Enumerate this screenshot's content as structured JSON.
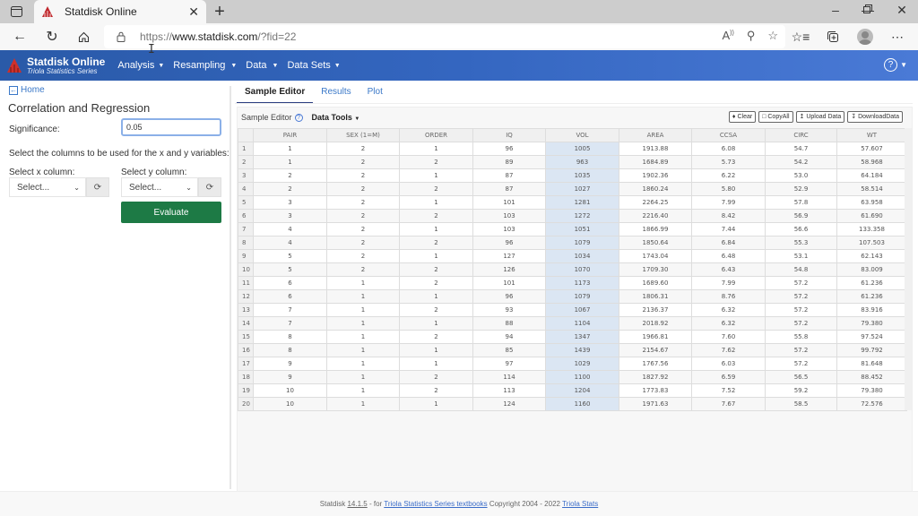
{
  "browser": {
    "tab_title": "Statdisk Online",
    "url_prefix": "https://",
    "url_host": "www.statdisk.com",
    "url_path": "/?fid=22",
    "icons": [
      "sidebar-icon",
      "close-icon",
      "new-tab-icon",
      "minimize-icon",
      "maximize-icon",
      "window-close-icon",
      "back-icon",
      "refresh-icon",
      "home-icon",
      "lock-icon",
      "read-aloud-icon",
      "zoom-out-icon",
      "add-favorite-icon",
      "favorites-icon",
      "collections-icon",
      "profile-icon",
      "more-icon"
    ]
  },
  "app": {
    "brand_name": "Statdisk Online",
    "brand_sub": "Triola Statistics Series",
    "menu": [
      {
        "label": "Analysis"
      },
      {
        "label": "Resampling"
      },
      {
        "label": "Data"
      },
      {
        "label": "Data Sets"
      }
    ],
    "accent": "#2a5aa8"
  },
  "left": {
    "home_label": "Home",
    "title": "Correlation and Regression",
    "significance_label": "Significance:",
    "significance_value": "0.05",
    "instructions": "Select the columns to be used for the x and y variables:",
    "x_label": "Select x column:",
    "y_label": "Select y column:",
    "x_select": "Select...",
    "y_select": "Select...",
    "evaluate_label": "Evaluate",
    "evaluate_color": "#1d7a45"
  },
  "right": {
    "tabs": [
      {
        "label": "Sample Editor",
        "active": true
      },
      {
        "label": "Results",
        "active": false
      },
      {
        "label": "Plot",
        "active": false
      }
    ],
    "editor_label": "Sample Editor",
    "data_tools": "Data Tools",
    "buttons": {
      "clear": "Clear",
      "copy_all": "CopyAll",
      "upload": "Upload Data",
      "download": "DownloadData"
    },
    "columns": [
      "PAIR",
      "SEX (1=M)",
      "ORDER",
      "IQ",
      "VOL",
      "AREA",
      "CCSA",
      "CIRC",
      "WT"
    ],
    "rows": [
      [
        "1",
        "2",
        "1",
        "96",
        "1005",
        "1913.88",
        "6.08",
        "54.7",
        "57.607"
      ],
      [
        "1",
        "2",
        "2",
        "89",
        "963",
        "1684.89",
        "5.73",
        "54.2",
        "58.968"
      ],
      [
        "2",
        "2",
        "1",
        "87",
        "1035",
        "1902.36",
        "6.22",
        "53.0",
        "64.184"
      ],
      [
        "2",
        "2",
        "2",
        "87",
        "1027",
        "1860.24",
        "5.80",
        "52.9",
        "58.514"
      ],
      [
        "3",
        "2",
        "1",
        "101",
        "1281",
        "2264.25",
        "7.99",
        "57.8",
        "63.958"
      ],
      [
        "3",
        "2",
        "2",
        "103",
        "1272",
        "2216.40",
        "8.42",
        "56.9",
        "61.690"
      ],
      [
        "4",
        "2",
        "1",
        "103",
        "1051",
        "1866.99",
        "7.44",
        "56.6",
        "133.358"
      ],
      [
        "4",
        "2",
        "2",
        "96",
        "1079",
        "1850.64",
        "6.84",
        "55.3",
        "107.503"
      ],
      [
        "5",
        "2",
        "1",
        "127",
        "1034",
        "1743.04",
        "6.48",
        "53.1",
        "62.143"
      ],
      [
        "5",
        "2",
        "2",
        "126",
        "1070",
        "1709.30",
        "6.43",
        "54.8",
        "83.009"
      ],
      [
        "6",
        "1",
        "2",
        "101",
        "1173",
        "1689.60",
        "7.99",
        "57.2",
        "61.236"
      ],
      [
        "6",
        "1",
        "1",
        "96",
        "1079",
        "1806.31",
        "8.76",
        "57.2",
        "61.236"
      ],
      [
        "7",
        "1",
        "2",
        "93",
        "1067",
        "2136.37",
        "6.32",
        "57.2",
        "83.916"
      ],
      [
        "7",
        "1",
        "1",
        "88",
        "1104",
        "2018.92",
        "6.32",
        "57.2",
        "79.380"
      ],
      [
        "8",
        "1",
        "2",
        "94",
        "1347",
        "1966.81",
        "7.60",
        "55.8",
        "97.524"
      ],
      [
        "8",
        "1",
        "1",
        "85",
        "1439",
        "2154.67",
        "7.62",
        "57.2",
        "99.792"
      ],
      [
        "9",
        "1",
        "1",
        "97",
        "1029",
        "1767.56",
        "6.03",
        "57.2",
        "81.648"
      ],
      [
        "9",
        "1",
        "2",
        "114",
        "1100",
        "1827.92",
        "6.59",
        "56.5",
        "88.452"
      ],
      [
        "10",
        "1",
        "2",
        "113",
        "1204",
        "1773.83",
        "7.52",
        "59.2",
        "79.380"
      ],
      [
        "10",
        "1",
        "1",
        "124",
        "1160",
        "1971.63",
        "7.67",
        "58.5",
        "72.576"
      ]
    ],
    "selected_column": "VOL"
  },
  "footer": {
    "prefix": "Statdisk",
    "version": "14.1.5",
    "mid": "- for",
    "link1": "Triola Statistics Series textbooks",
    "copyright": "Copyright 2004 - 2022",
    "link2": "Triola Stats"
  }
}
